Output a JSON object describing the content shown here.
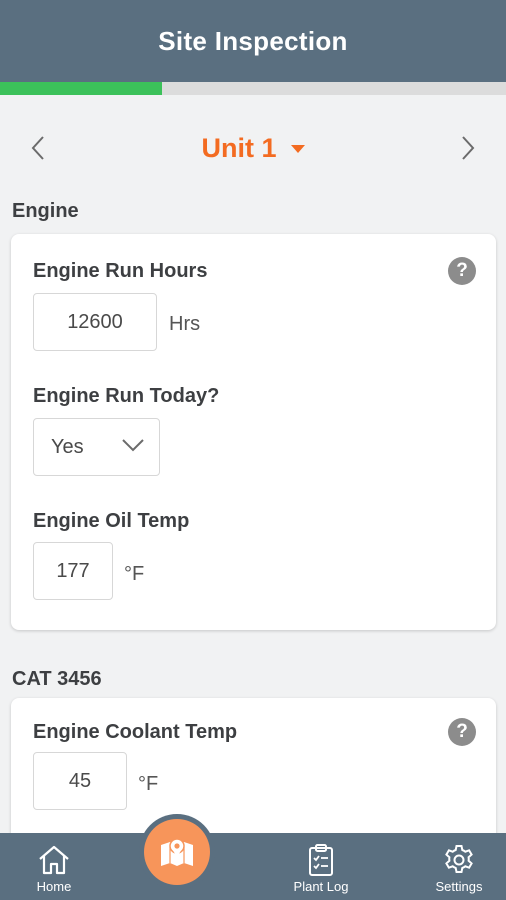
{
  "header": {
    "title": "Site Inspection"
  },
  "progress": {
    "fraction": 0.32,
    "color": "#3cc15a"
  },
  "unit_nav": {
    "current_unit": "Unit 1",
    "accent": "#f36b21"
  },
  "sections": [
    {
      "title": "Engine",
      "fields": [
        {
          "label": "Engine Run Hours",
          "value": "12600",
          "unit": "Hrs",
          "help": "?"
        },
        {
          "label": "Engine Run Today?",
          "selected": "Yes"
        },
        {
          "label": "Engine Oil Temp",
          "value": "177",
          "unit": "°F"
        }
      ]
    },
    {
      "title": "CAT 3456",
      "fields": [
        {
          "label": "Engine Coolant Temp",
          "value": "45",
          "unit": "°F",
          "help": "?"
        }
      ]
    }
  ],
  "tabbar": {
    "items": [
      {
        "label": "Home",
        "icon": "home-icon"
      },
      {
        "label": "Plant Log",
        "icon": "clipboard-icon"
      },
      {
        "label": "Settings",
        "icon": "gear-icon"
      }
    ],
    "center_icon": "map-pin-icon",
    "bar_color": "#5a6f80",
    "center_color": "#f7955a"
  }
}
